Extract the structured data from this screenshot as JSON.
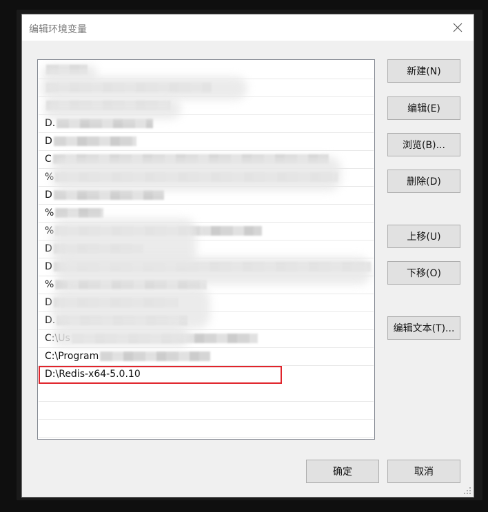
{
  "dialog": {
    "title": "编辑环境变量"
  },
  "list": {
    "rows": [
      {
        "prefix": "",
        "blurred": true
      },
      {
        "prefix": "",
        "blurred": true
      },
      {
        "prefix": "",
        "blurred": true
      },
      {
        "prefix": "D.",
        "blurred": true
      },
      {
        "prefix": "D",
        "blurred": true
      },
      {
        "prefix": "C",
        "blurred": true
      },
      {
        "prefix": "%",
        "blurred": true
      },
      {
        "prefix": "D",
        "blurred": true
      },
      {
        "prefix": "%",
        "blurred": true
      },
      {
        "prefix": "%",
        "blurred": true
      },
      {
        "prefix": "D",
        "blurred": true
      },
      {
        "prefix": "D",
        "blurred": true
      },
      {
        "prefix": "%",
        "blurred": true
      },
      {
        "prefix": "D",
        "blurred": true
      },
      {
        "prefix": "D.",
        "blurred": true
      },
      {
        "prefix": "C:\\Us",
        "blurred": true
      },
      {
        "prefix": "C:\\Program",
        "blurred": true
      },
      {
        "prefix": "D:\\Redis-x64-5.0.10",
        "blurred": false,
        "selected": true
      }
    ]
  },
  "buttons": {
    "new": "新建(N)",
    "edit": "编辑(E)",
    "browse": "浏览(B)...",
    "delete": "删除(D)",
    "move_up": "上移(U)",
    "move_down": "下移(O)",
    "edit_text": "编辑文本(T)...",
    "ok": "确定",
    "cancel": "取消"
  },
  "colors": {
    "selection_outline": "#e0242b"
  }
}
